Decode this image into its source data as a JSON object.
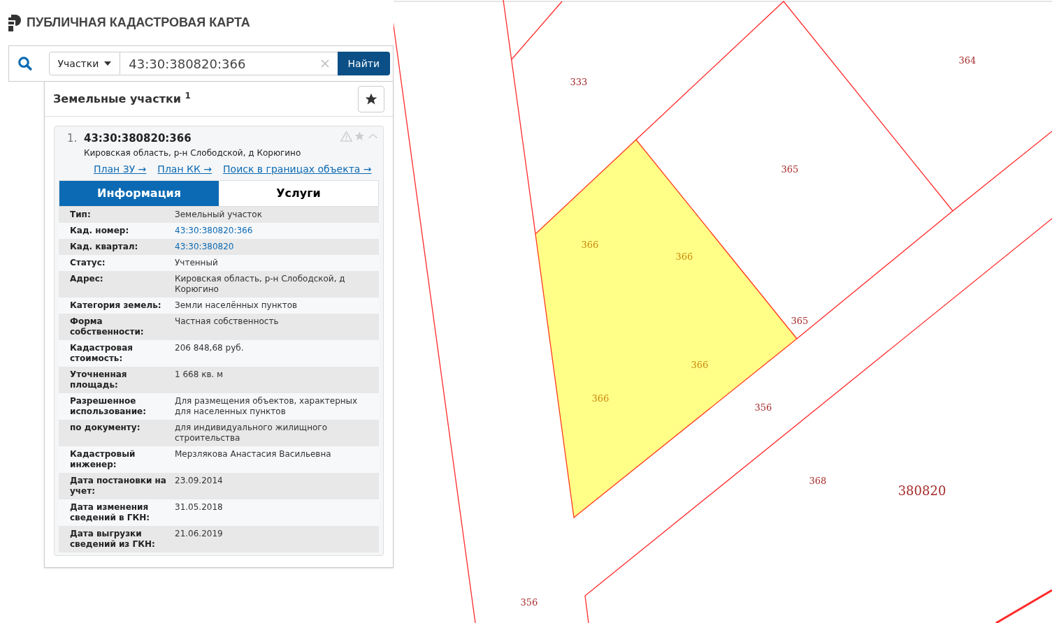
{
  "header": {
    "title": "ПУБЛИЧНАЯ КАДАСТРОВАЯ КАРТА"
  },
  "search": {
    "category": "Участки",
    "value": "43:30:380820:366",
    "button": "Найти"
  },
  "results": {
    "title": "Земельные участки $^{1}$",
    "items": [
      {
        "number": "1.",
        "cadastral_number": "43:30:380820:366",
        "address": "Кировская область, р-н Слободской, д Корюгино",
        "links": [
          "План ЗУ →",
          "План КК →",
          "Поиск в границах объекта →"
        ],
        "tabs": [
          {
            "label": "Информация",
            "selected": true
          },
          {
            "label": "Услуги",
            "selected": false
          }
        ],
        "rows": [
          {
            "label": "Тип:",
            "value": "Земельный участок",
            "kind": "text"
          },
          {
            "label": "Кад. номер:",
            "value": "43:30:380820:366",
            "kind": "link"
          },
          {
            "label": "Кад. квартал:",
            "value": "43:30:380820",
            "kind": "link"
          },
          {
            "label": "Статус:",
            "value": "Учтенный",
            "kind": "text"
          },
          {
            "label": "Адрес:",
            "value": "Кировская область, р-н Слободской, д Корюгино",
            "kind": "text"
          },
          {
            "label": "Категория земель:",
            "value": "Земли населённых пунктов",
            "kind": "text"
          },
          {
            "label": "Форма собственности:",
            "value": "Частная собственность",
            "kind": "text"
          },
          {
            "label": "Кадастровая стоимость:",
            "value": "206 848,68 руб.",
            "kind": "text"
          },
          {
            "label": "Уточненная площадь:",
            "value": "1 668 кв. м",
            "kind": "text"
          },
          {
            "label": "Разрешенное использование:",
            "value": "Для размещения объектов, характерных для населенных пунктов",
            "kind": "text"
          },
          {
            "label": "по документу:",
            "value": "для индивидуального жилищного строительства",
            "kind": "text"
          },
          {
            "label": "Кадастровый инженер:",
            "value": "Мерзлякова Анастасия Васильевна",
            "kind": "text"
          },
          {
            "label": "Дата постановки на учет:",
            "value": "23.09.2014",
            "kind": "text"
          },
          {
            "label": "Дата изменения сведений в ГКН:",
            "value": "31.05.2018",
            "kind": "text"
          },
          {
            "label": "Дата выгрузки сведений из ГКН:",
            "value": "21.06.2019",
            "kind": "text"
          }
        ]
      }
    ]
  },
  "map": {
    "labels": [
      {
        "text": "333",
        "kind": "parcel"
      },
      {
        "text": "364",
        "kind": "parcel"
      },
      {
        "text": "365",
        "kind": "parcel"
      },
      {
        "text": "366",
        "kind": "selected"
      },
      {
        "text": "366",
        "kind": "selected"
      },
      {
        "text": "365",
        "kind": "parcel"
      },
      {
        "text": "366",
        "kind": "selected"
      },
      {
        "text": "366",
        "kind": "selected"
      },
      {
        "text": "356",
        "kind": "parcel"
      },
      {
        "text": "368",
        "kind": "parcel"
      },
      {
        "text": "380820",
        "kind": "quarter"
      },
      {
        "text": "356",
        "kind": "parcel"
      }
    ]
  }
}
